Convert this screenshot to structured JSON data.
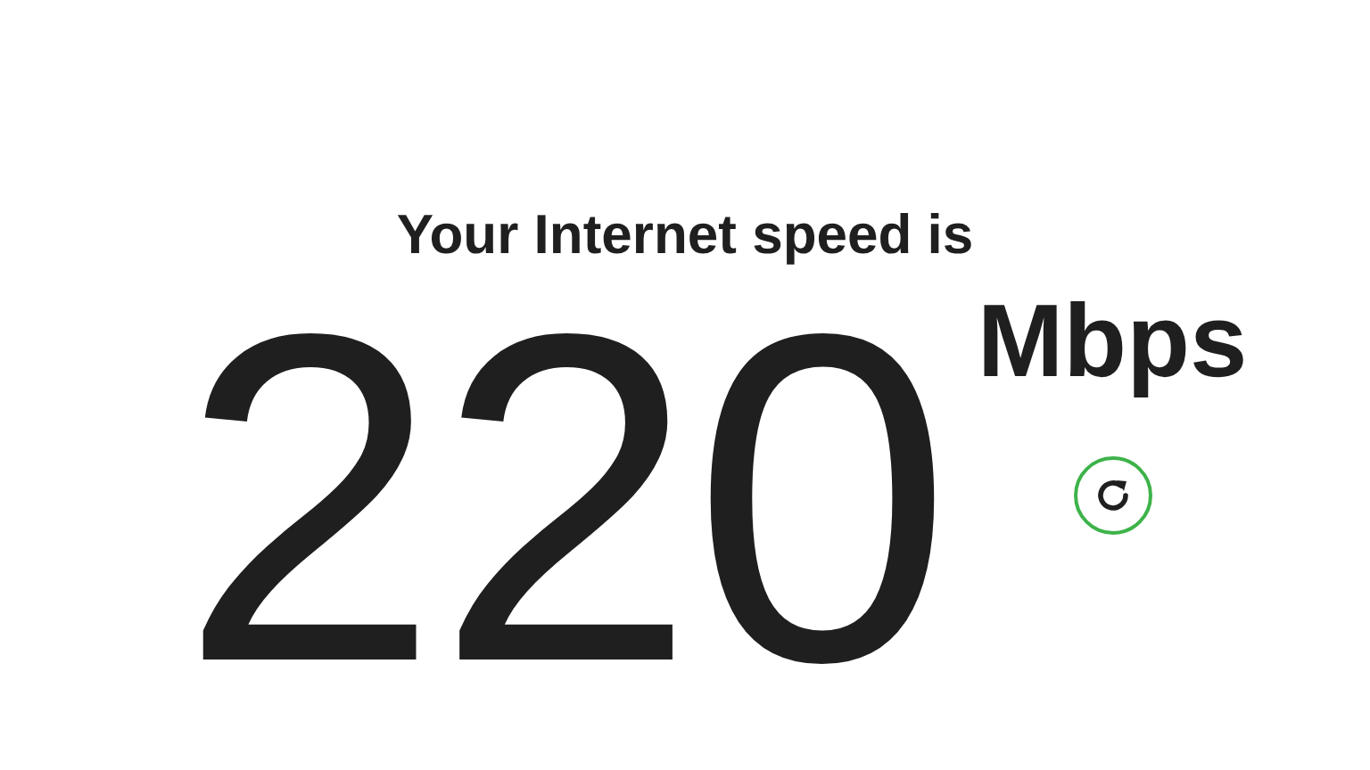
{
  "heading": "Your Internet speed is",
  "speed": {
    "value": "220",
    "unit": "Mbps"
  },
  "refresh_button": {
    "kind": "refresh"
  }
}
